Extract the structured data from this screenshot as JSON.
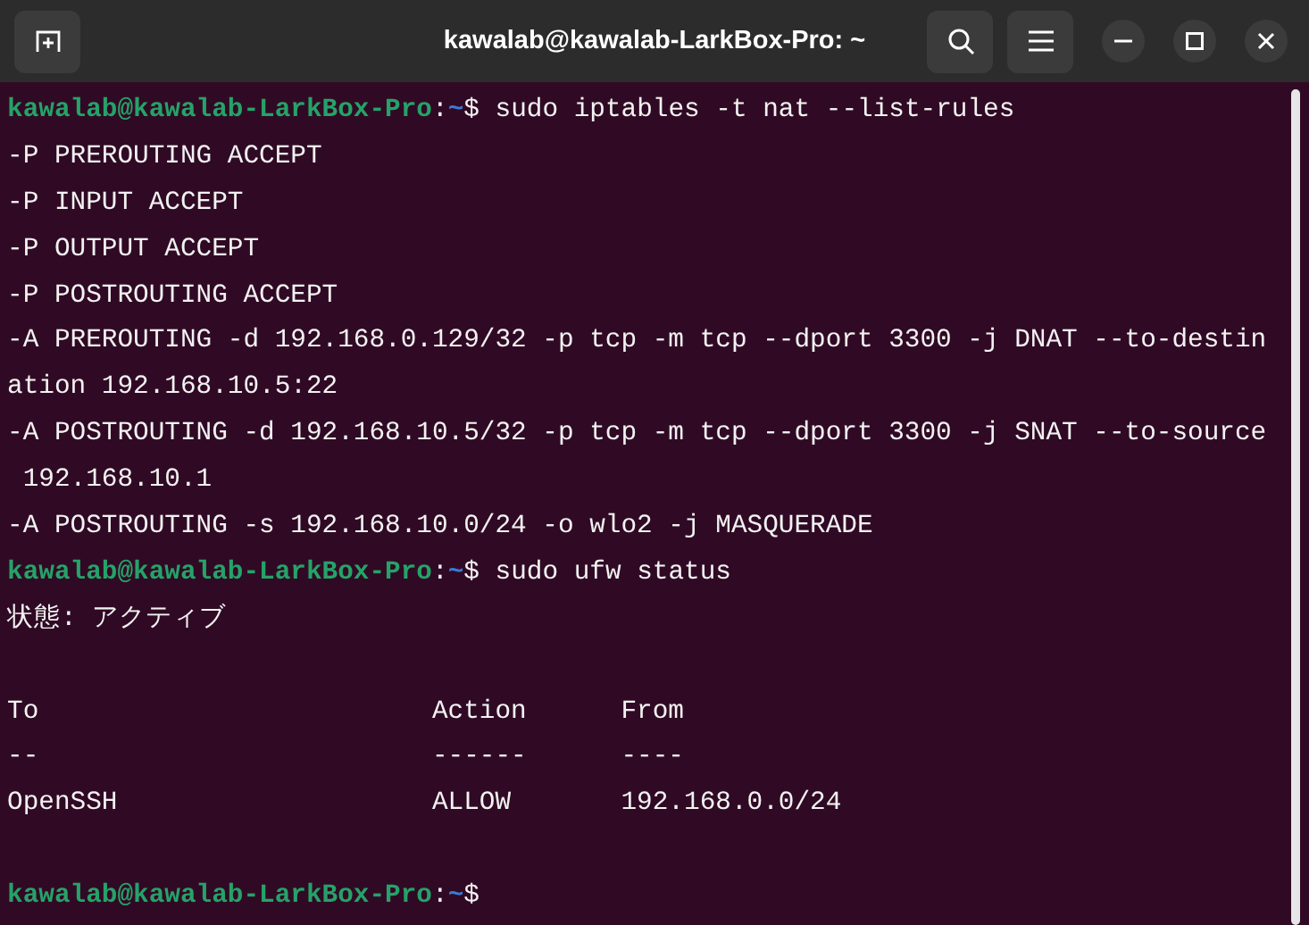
{
  "window": {
    "title": "kawalab@kawalab-LarkBox-Pro: ~"
  },
  "terminal": {
    "lines": [
      {
        "kind": "prompt",
        "user_host": "kawalab@kawalab-LarkBox-Pro",
        "separator": ":",
        "path": "~",
        "symbol": "$",
        "command": " sudo iptables -t nat --list-rules"
      },
      {
        "kind": "output",
        "text": "-P PREROUTING ACCEPT"
      },
      {
        "kind": "output",
        "text": "-P INPUT ACCEPT"
      },
      {
        "kind": "output",
        "text": "-P OUTPUT ACCEPT"
      },
      {
        "kind": "output",
        "text": "-P POSTROUTING ACCEPT"
      },
      {
        "kind": "output",
        "text": "-A PREROUTING -d 192.168.0.129/32 -p tcp -m tcp --dport 3300 -j DNAT --to-destin"
      },
      {
        "kind": "output",
        "text": "ation 192.168.10.5:22"
      },
      {
        "kind": "output",
        "text": "-A POSTROUTING -d 192.168.10.5/32 -p tcp -m tcp --dport 3300 -j SNAT --to-source"
      },
      {
        "kind": "output",
        "text": " 192.168.10.1"
      },
      {
        "kind": "output",
        "text": "-A POSTROUTING -s 192.168.10.0/24 -o wlo2 -j MASQUERADE"
      },
      {
        "kind": "prompt",
        "user_host": "kawalab@kawalab-LarkBox-Pro",
        "separator": ":",
        "path": "~",
        "symbol": "$",
        "command": " sudo ufw status"
      },
      {
        "kind": "output",
        "text": "状態: アクティブ"
      },
      {
        "kind": "blank"
      },
      {
        "kind": "output",
        "text": "To                         Action      From"
      },
      {
        "kind": "output",
        "text": "--                         ------      ----"
      },
      {
        "kind": "output",
        "text": "OpenSSH                    ALLOW       192.168.0.0/24"
      },
      {
        "kind": "blank"
      },
      {
        "kind": "prompt",
        "user_host": "kawalab@kawalab-LarkBox-Pro",
        "separator": ":",
        "path": "~",
        "symbol": "$"
      }
    ]
  }
}
